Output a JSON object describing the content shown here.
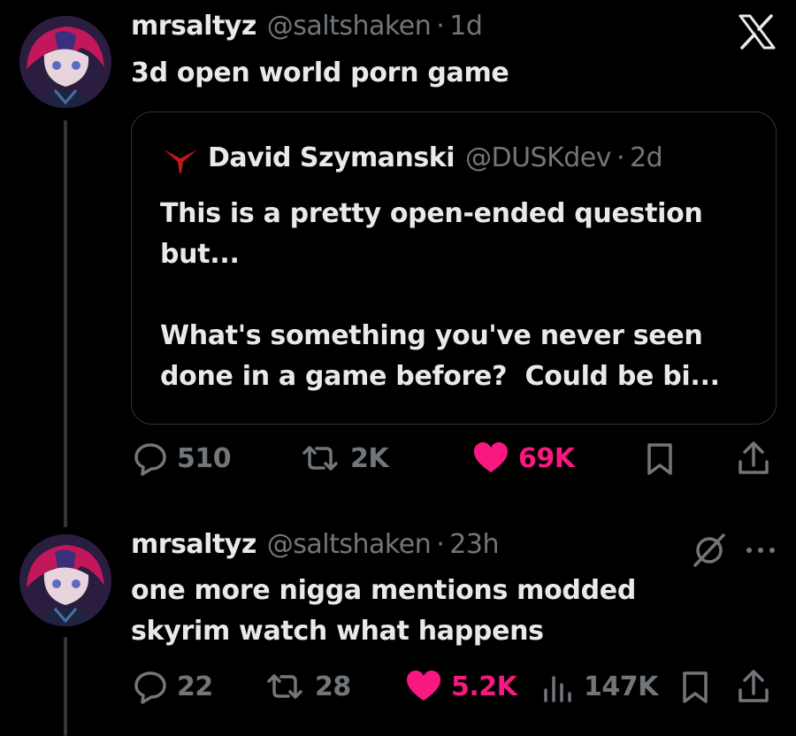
{
  "tweet1": {
    "display_name": "mrsaltyz",
    "handle": "@saltshaken",
    "separator": "·",
    "time": "1d",
    "text": "3d open world porn game",
    "quote": {
      "display_name": "David Szymanski",
      "handle": "@DUSKdev",
      "separator": "·",
      "time": "2d",
      "text": "This is a pretty open-ended question\nbut...\n\nWhat's something you've never seen\ndone in a game before?  Could be bi..."
    },
    "actions": {
      "replies": "510",
      "reposts": "2K",
      "likes": "69K"
    }
  },
  "tweet2": {
    "display_name": "mrsaltyz",
    "handle": "@saltshaken",
    "separator": "·",
    "time": "23h",
    "text": "one more nigga mentions modded\nskyrim watch what happens",
    "actions": {
      "replies": "22",
      "reposts": "28",
      "likes": "5.2K",
      "views": "147K"
    }
  },
  "colors": {
    "background": "#000000",
    "text": "#e7e9ea",
    "muted": "#71767b",
    "like": "#f91880",
    "border": "#2f3336",
    "quote_logo": "#c0161c"
  },
  "icons": [
    "x-logo-icon",
    "reply-icon",
    "repost-icon",
    "heart-icon",
    "bookmark-icon",
    "share-icon",
    "views-icon",
    "grok-icon",
    "more-icon"
  ]
}
